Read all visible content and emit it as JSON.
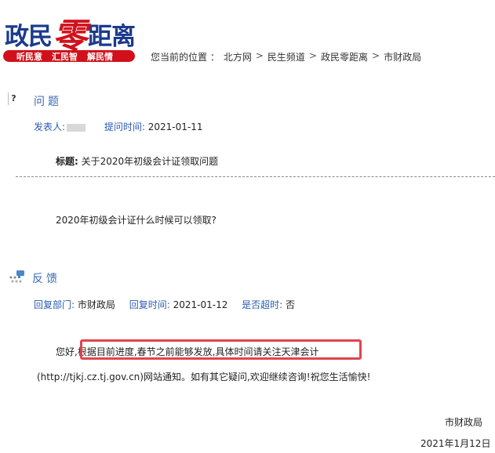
{
  "header": {
    "logo_part1": "政民",
    "logo_part2": "零",
    "logo_part3": "距离",
    "slogans": [
      "听民意",
      "汇民智",
      "解民情"
    ],
    "breadcrumb_prefix": "您当前的位置 ：",
    "breadcrumb": [
      "北方网",
      "民生频道",
      "政民零距离",
      "市财政局"
    ],
    "breadcrumb_sep": ">"
  },
  "question": {
    "section_title": "问题",
    "author_label": "发表人:",
    "time_label": "提问时间:",
    "time_value": "2021-01-11",
    "title_label": "标题:",
    "title_value": "关于2020年初级会计证领取问题",
    "body": "2020年初级会计证什么时候可以领取?"
  },
  "feedback": {
    "section_title": "反馈",
    "dept_label": "回复部门:",
    "dept_value": "市财政局",
    "time_label": "回复时间:",
    "time_value": "2021-01-12",
    "overdue_label": "是否超时:",
    "overdue_value": "否",
    "reply_prefix": "您好,",
    "reply_highlight": "根据目前进度,春节之前能够发放,具体时间请关注天津会计",
    "reply_line2": "(http://tjkj.cz.tj.gov.cn)网站通知。如有其它疑问,欢迎继续咨询!祝您生活愉快!",
    "signature": "市财政局",
    "date": "2021年1月12日"
  },
  "colors": {
    "brand_red": "#d0111b",
    "brand_blue": "#1a3a8c",
    "label_blue": "#2a5cb0",
    "highlight_red": "#e0454c"
  }
}
